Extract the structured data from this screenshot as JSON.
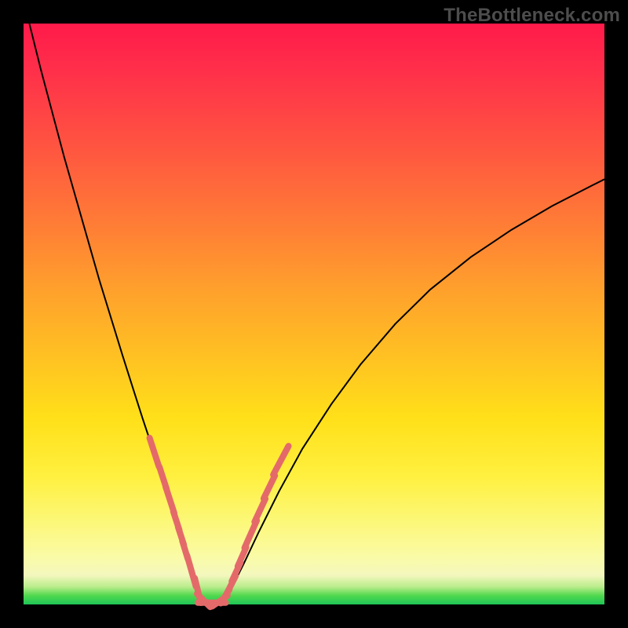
{
  "watermark": "TheBottleneck.com",
  "chart_data": {
    "type": "line",
    "title": "",
    "xlabel": "",
    "ylabel": "",
    "xlim": [
      0,
      100
    ],
    "ylim": [
      0,
      100
    ],
    "grid": false,
    "legend": false,
    "background_gradient": [
      "#ff1a4a",
      "#ff7b36",
      "#ffe019",
      "#fcf87a",
      "#1fc557"
    ],
    "series": [
      {
        "name": "left-branch",
        "color": "#000000",
        "x": [
          1,
          3,
          5,
          7,
          9,
          11,
          13,
          15,
          17,
          19,
          20.5,
          22,
          23.5,
          25,
          26,
          27,
          28,
          28.7,
          29.3,
          30,
          30.7
        ],
        "y": [
          100,
          92,
          84.5,
          77,
          70,
          63,
          56,
          49.5,
          43,
          36.7,
          32,
          27.5,
          23,
          18.7,
          15.3,
          12,
          8.8,
          6.3,
          4.2,
          2.2,
          0.8
        ]
      },
      {
        "name": "valley-floor",
        "color": "#000000",
        "x": [
          30.7,
          31.3,
          32,
          32.7,
          33.3,
          34,
          34.7
        ],
        "y": [
          0.8,
          0.3,
          0.15,
          0.15,
          0.25,
          0.5,
          1.0
        ]
      },
      {
        "name": "right-branch",
        "color": "#000000",
        "x": [
          34.7,
          36,
          38,
          40.5,
          44,
          48,
          53,
          58,
          64,
          70,
          77,
          84,
          91,
          98,
          100
        ],
        "y": [
          1.0,
          3.2,
          7.2,
          12.5,
          19.5,
          26.8,
          34.5,
          41.3,
          48.3,
          54.2,
          59.8,
          64.5,
          68.6,
          72.2,
          73.2
        ]
      }
    ],
    "markers": {
      "name": "highlighted-points",
      "color": "#e46a6a",
      "shape": "capsule",
      "points": [
        {
          "x": 22.5,
          "y": 26.2,
          "len": 2.6,
          "angle": -72
        },
        {
          "x": 24.0,
          "y": 21.8,
          "len": 2.0,
          "angle": -72
        },
        {
          "x": 25.2,
          "y": 18.0,
          "len": 2.4,
          "angle": -72
        },
        {
          "x": 26.3,
          "y": 14.4,
          "len": 1.7,
          "angle": -72
        },
        {
          "x": 27.1,
          "y": 11.8,
          "len": 1.6,
          "angle": -72
        },
        {
          "x": 27.8,
          "y": 9.4,
          "len": 1.6,
          "angle": -73
        },
        {
          "x": 28.9,
          "y": 5.8,
          "len": 2.8,
          "angle": -74
        },
        {
          "x": 30.0,
          "y": 2.4,
          "len": 2.2,
          "angle": -76
        },
        {
          "x": 31.0,
          "y": 0.7,
          "len": 1.6,
          "angle": -45
        },
        {
          "x": 32.4,
          "y": 0.3,
          "len": 2.4,
          "angle": 0
        },
        {
          "x": 33.8,
          "y": 0.6,
          "len": 1.6,
          "angle": 35
        },
        {
          "x": 34.7,
          "y": 1.4,
          "len": 1.4,
          "angle": 58
        },
        {
          "x": 35.6,
          "y": 3.1,
          "len": 2.0,
          "angle": 63
        },
        {
          "x": 36.6,
          "y": 5.6,
          "len": 1.8,
          "angle": 65
        },
        {
          "x": 37.6,
          "y": 8.2,
          "len": 1.8,
          "angle": 66
        },
        {
          "x": 39.1,
          "y": 12.1,
          "len": 2.6,
          "angle": 66
        },
        {
          "x": 40.7,
          "y": 16.2,
          "len": 2.2,
          "angle": 65
        },
        {
          "x": 42.3,
          "y": 20.2,
          "len": 2.2,
          "angle": 64
        },
        {
          "x": 44.3,
          "y": 24.8,
          "len": 2.8,
          "angle": 62
        }
      ]
    }
  }
}
